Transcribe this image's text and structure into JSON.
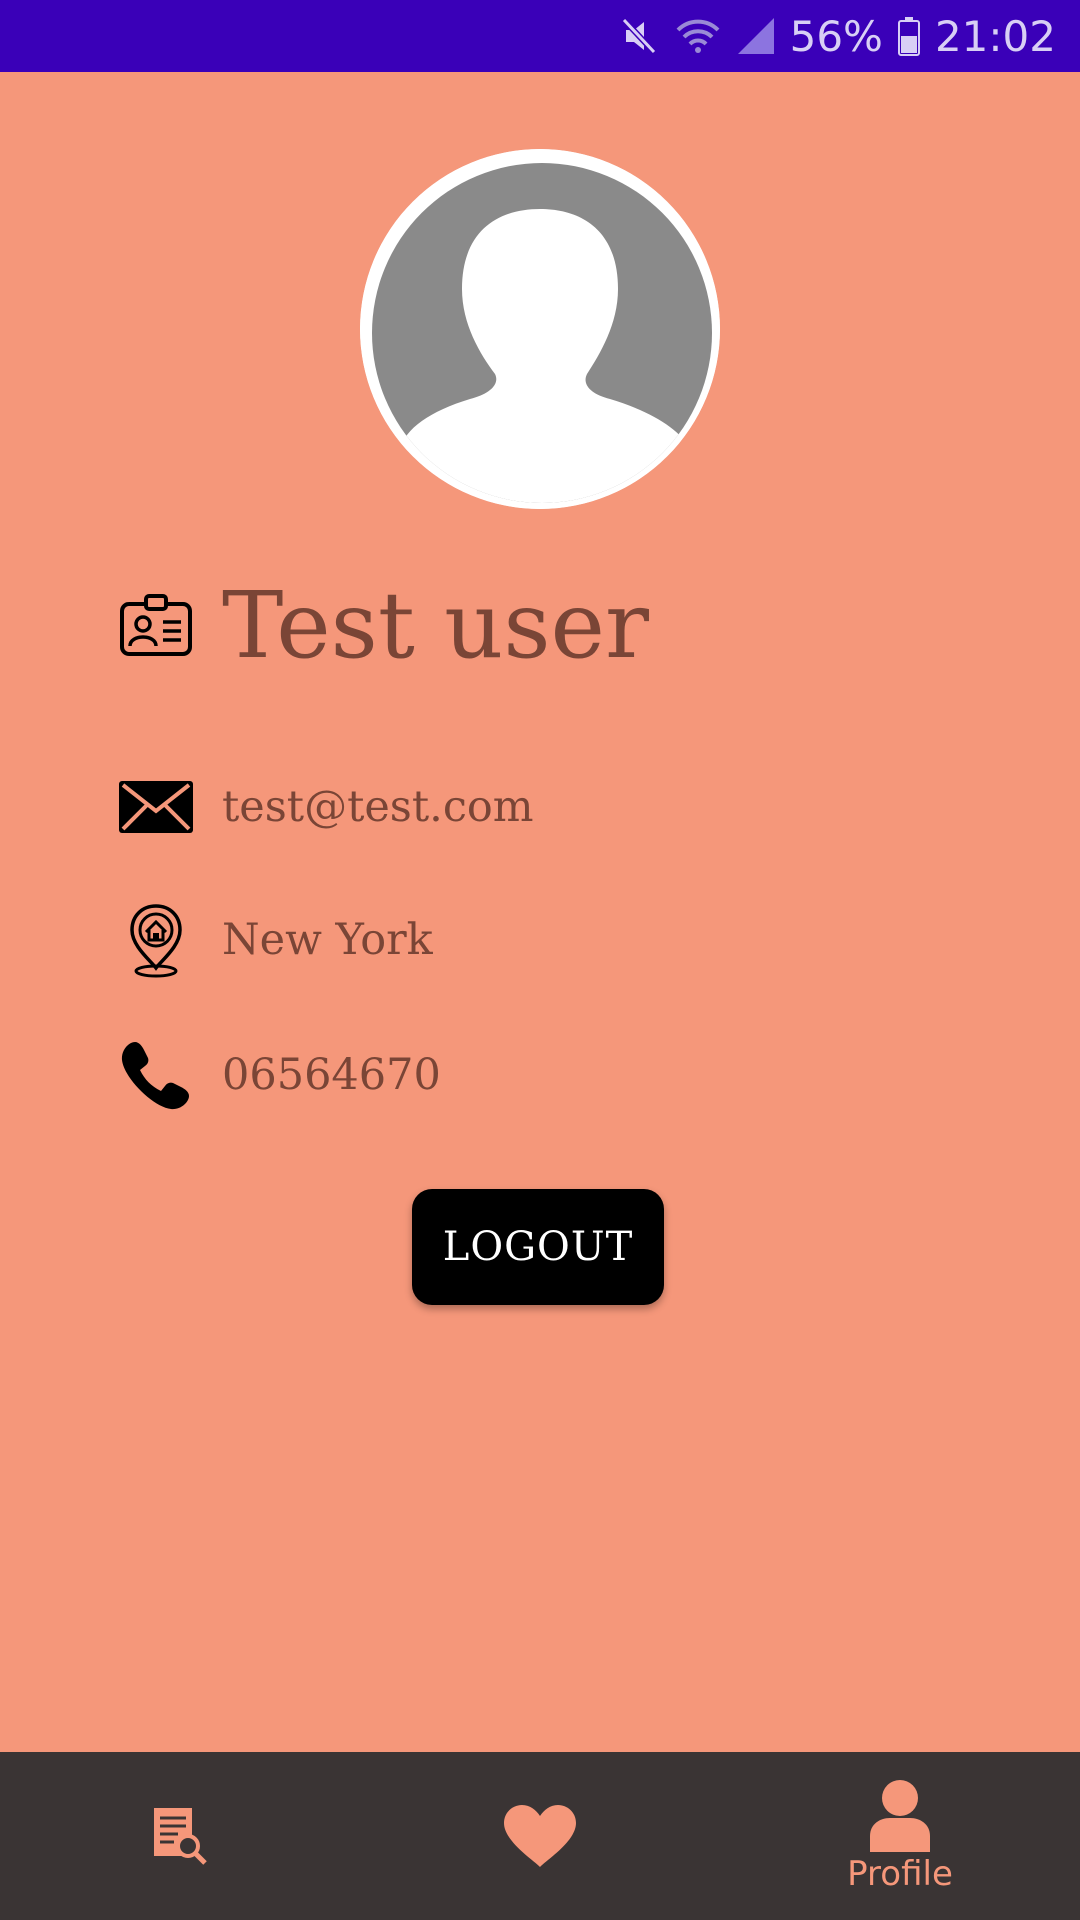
{
  "status_bar": {
    "battery": "56%",
    "time": "21:02",
    "icons": [
      "mute-icon",
      "wifi-icon",
      "signal-icon",
      "battery-icon"
    ]
  },
  "profile": {
    "avatar_icon": "default-user-avatar",
    "name": "Test user",
    "name_icon": "id-card-icon",
    "email": "test@test.com",
    "email_icon": "envelope-icon",
    "city": "New York",
    "city_icon": "home-location-pin-icon",
    "phone": "06564670",
    "phone_icon": "phone-icon"
  },
  "actions": {
    "logout_label": "LOGOUT"
  },
  "bottom_nav": {
    "items": [
      {
        "icon": "document-search-icon",
        "label": ""
      },
      {
        "icon": "heart-icon",
        "label": ""
      },
      {
        "icon": "person-icon",
        "label": "Profile"
      }
    ]
  },
  "colors": {
    "status_bar": "#3a00b8",
    "background": "#f5977a",
    "text": "#7a4536",
    "button": "#000000",
    "nav_background": "#3a3434",
    "nav_accent": "#f5977a"
  }
}
